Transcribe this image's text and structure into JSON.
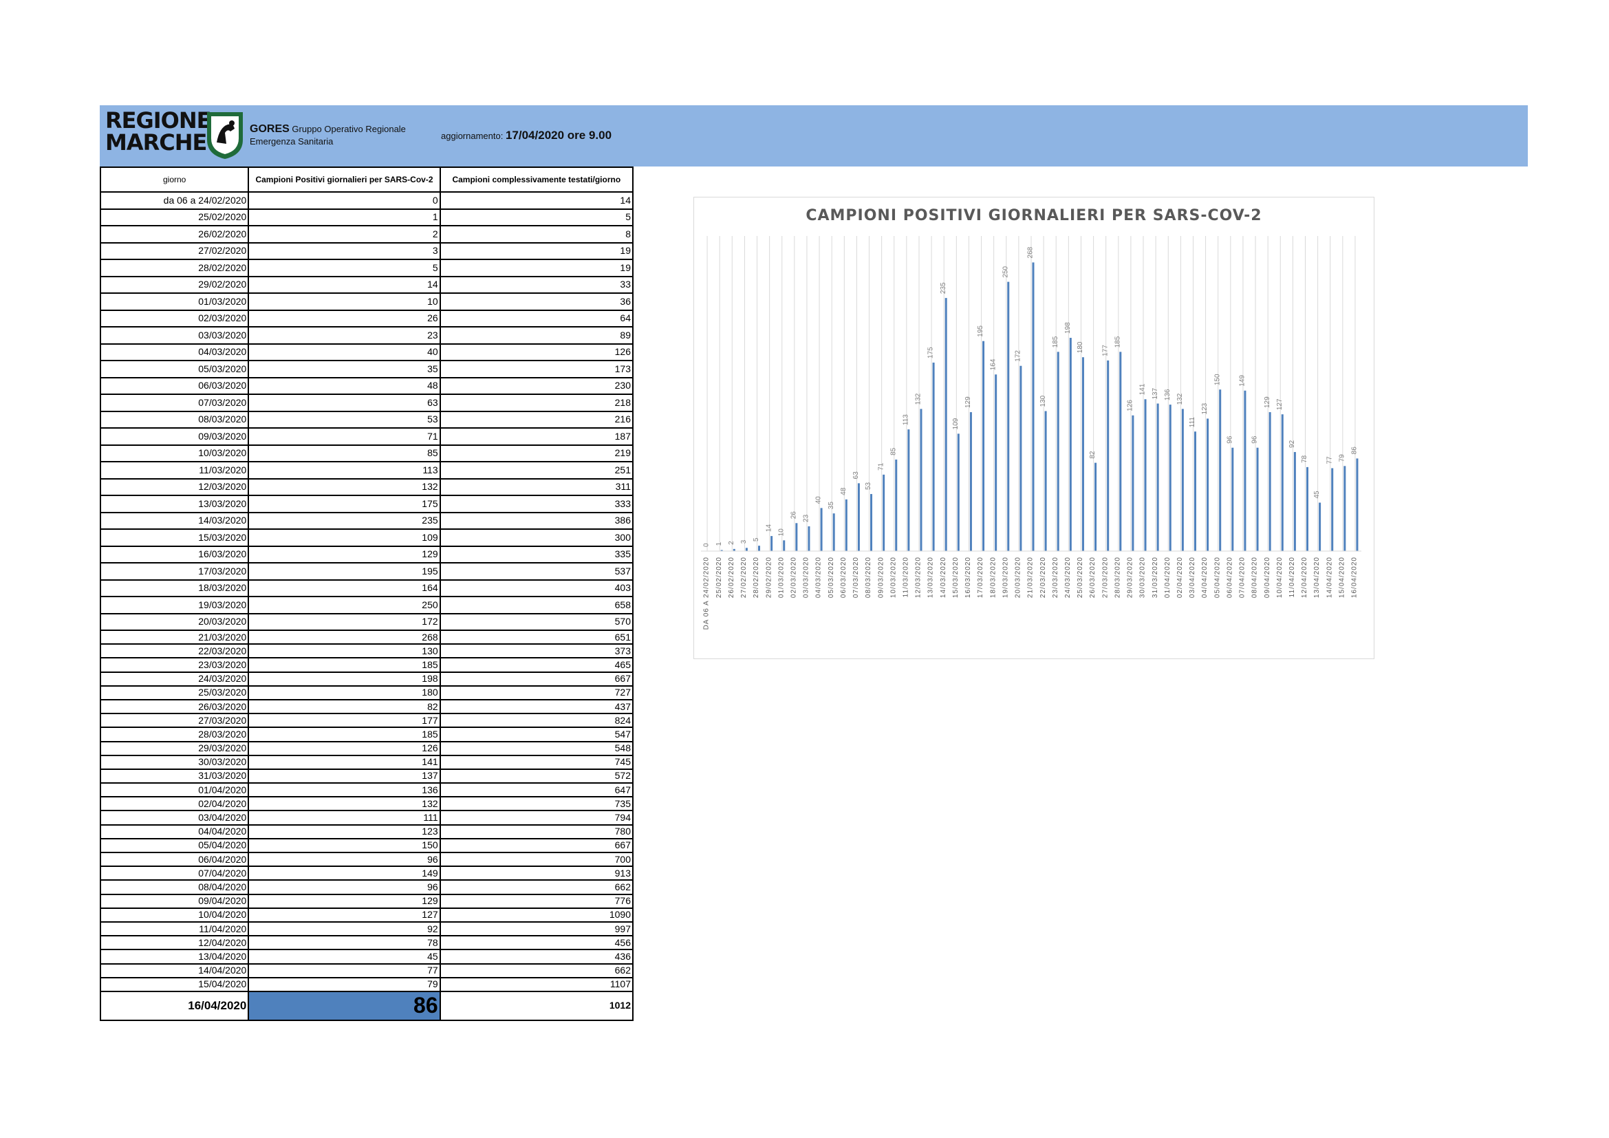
{
  "header": {
    "logo_line1": "REGIONE",
    "logo_line2": "MARCHE",
    "org_short": "GORES",
    "org_desc1": "Gruppo Operativo Regionale",
    "org_desc2": "Emergenza Sanitaria",
    "update_label": "aggiornamento:",
    "update_value": "17/04/2020 ore 9.00"
  },
  "table": {
    "columns": [
      "giorno",
      "Campioni Positivi giornalieri per SARS-Cov-2",
      "Campioni complessivamente testati/giorno"
    ],
    "rows": [
      [
        "da 06 a 24/02/2020",
        "0",
        "14"
      ],
      [
        "25/02/2020",
        "1",
        "5"
      ],
      [
        "26/02/2020",
        "2",
        "8"
      ],
      [
        "27/02/2020",
        "3",
        "19"
      ],
      [
        "28/02/2020",
        "5",
        "19"
      ],
      [
        "29/02/2020",
        "14",
        "33"
      ],
      [
        "01/03/2020",
        "10",
        "36"
      ],
      [
        "02/03/2020",
        "26",
        "64"
      ],
      [
        "03/03/2020",
        "23",
        "89"
      ],
      [
        "04/03/2020",
        "40",
        "126"
      ],
      [
        "05/03/2020",
        "35",
        "173"
      ],
      [
        "06/03/2020",
        "48",
        "230"
      ],
      [
        "07/03/2020",
        "63",
        "218"
      ],
      [
        "08/03/2020",
        "53",
        "216"
      ],
      [
        "09/03/2020",
        "71",
        "187"
      ],
      [
        "10/03/2020",
        "85",
        "219"
      ],
      [
        "11/03/2020",
        "113",
        "251"
      ],
      [
        "12/03/2020",
        "132",
        "311"
      ],
      [
        "13/03/2020",
        "175",
        "333"
      ],
      [
        "14/03/2020",
        "235",
        "386"
      ],
      [
        "15/03/2020",
        "109",
        "300"
      ],
      [
        "16/03/2020",
        "129",
        "335"
      ],
      [
        "17/03/2020",
        "195",
        "537"
      ],
      [
        "18/03/2020",
        "164",
        "403"
      ],
      [
        "19/03/2020",
        "250",
        "658"
      ],
      [
        "20/03/2020",
        "172",
        "570"
      ],
      [
        "21/03/2020",
        "268",
        "651"
      ],
      [
        "22/03/2020",
        "130",
        "373"
      ],
      [
        "23/03/2020",
        "185",
        "465"
      ],
      [
        "24/03/2020",
        "198",
        "667"
      ],
      [
        "25/03/2020",
        "180",
        "727"
      ],
      [
        "26/03/2020",
        "82",
        "437"
      ],
      [
        "27/03/2020",
        "177",
        "824"
      ],
      [
        "28/03/2020",
        "185",
        "547"
      ],
      [
        "29/03/2020",
        "126",
        "548"
      ],
      [
        "30/03/2020",
        "141",
        "745"
      ],
      [
        "31/03/2020",
        "137",
        "572"
      ],
      [
        "01/04/2020",
        "136",
        "647"
      ],
      [
        "02/04/2020",
        "132",
        "735"
      ],
      [
        "03/04/2020",
        "111",
        "794"
      ],
      [
        "04/04/2020",
        "123",
        "780"
      ],
      [
        "05/04/2020",
        "150",
        "667"
      ],
      [
        "06/04/2020",
        "96",
        "700"
      ],
      [
        "07/04/2020",
        "149",
        "913"
      ],
      [
        "08/04/2020",
        "96",
        "662"
      ],
      [
        "09/04/2020",
        "129",
        "776"
      ],
      [
        "10/04/2020",
        "127",
        "1090"
      ],
      [
        "11/04/2020",
        "92",
        "997"
      ],
      [
        "12/04/2020",
        "78",
        "456"
      ],
      [
        "13/04/2020",
        "45",
        "436"
      ],
      [
        "14/04/2020",
        "77",
        "662"
      ],
      [
        "15/04/2020",
        "79",
        "1107"
      ]
    ],
    "last_row": [
      "16/04/2020",
      "86",
      "1012"
    ]
  },
  "colors": {
    "header_bg": "#8eb4e3",
    "highlight_cell": "#4f81bd",
    "bar": "#4f81bd",
    "label_gray": "#808080"
  },
  "chart_data": {
    "type": "bar",
    "title": "CAMPIONI POSITIVI GIORNALIERI PER SARS-COV-2",
    "categories": [
      "DA 06 A 24/02/2020",
      "25/02/2020",
      "26/02/2020",
      "27/02/2020",
      "28/02/2020",
      "29/02/2020",
      "01/03/2020",
      "02/03/2020",
      "03/03/2020",
      "04/03/2020",
      "05/03/2020",
      "06/03/2020",
      "07/03/2020",
      "08/03/2020",
      "09/03/2020",
      "10/03/2020",
      "11/03/2020",
      "12/03/2020",
      "13/03/2020",
      "14/03/2020",
      "15/03/2020",
      "16/03/2020",
      "17/03/2020",
      "18/03/2020",
      "19/03/2020",
      "20/03/2020",
      "21/03/2020",
      "22/03/2020",
      "23/03/2020",
      "24/03/2020",
      "25/03/2020",
      "26/03/2020",
      "27/03/2020",
      "28/03/2020",
      "29/03/2020",
      "30/03/2020",
      "31/03/2020",
      "01/04/2020",
      "02/04/2020",
      "03/04/2020",
      "04/04/2020",
      "05/04/2020",
      "06/04/2020",
      "07/04/2020",
      "08/04/2020",
      "09/04/2020",
      "10/04/2020",
      "11/04/2020",
      "12/04/2020",
      "13/04/2020",
      "14/04/2020",
      "15/04/2020",
      "16/04/2020"
    ],
    "values": [
      0,
      1,
      2,
      3,
      5,
      14,
      10,
      26,
      23,
      40,
      35,
      48,
      63,
      53,
      71,
      85,
      113,
      132,
      175,
      235,
      109,
      129,
      195,
      164,
      250,
      172,
      268,
      130,
      185,
      198,
      180,
      82,
      177,
      185,
      126,
      141,
      137,
      136,
      132,
      111,
      123,
      150,
      96,
      149,
      96,
      129,
      127,
      92,
      78,
      45,
      77,
      79,
      86
    ],
    "xlabel": "",
    "ylabel": "",
    "ylim": [
      0,
      290
    ],
    "grid": "vertical",
    "data_labels": true
  }
}
